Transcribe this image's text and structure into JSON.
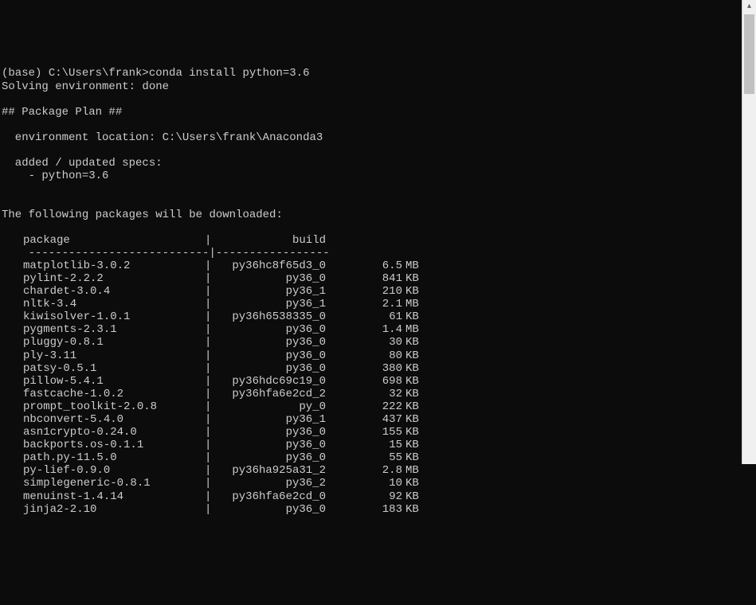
{
  "prompt": {
    "env": "(base) ",
    "path": "C:\\Users\\frank>",
    "command": "conda install python=3.6"
  },
  "solving": "Solving environment: done",
  "plan_header": "## Package Plan ##",
  "env_location_label": "  environment location: ",
  "env_location_value": "C:\\Users\\frank\\Anaconda3",
  "specs_header": "  added / updated specs:",
  "spec_item": "    - python=3.6",
  "download_header": "The following packages will be downloaded:",
  "table_header": {
    "package": "package",
    "build": "build"
  },
  "table_divider": "    ---------------------------|-----------------",
  "packages": [
    {
      "name": "matplotlib-3.0.2",
      "build": "py36hc8f65d3_0",
      "size": "6.5",
      "unit": "MB"
    },
    {
      "name": "pylint-2.2.2",
      "build": "py36_0",
      "size": "841",
      "unit": "KB"
    },
    {
      "name": "chardet-3.0.4",
      "build": "py36_1",
      "size": "210",
      "unit": "KB"
    },
    {
      "name": "nltk-3.4",
      "build": "py36_1",
      "size": "2.1",
      "unit": "MB"
    },
    {
      "name": "kiwisolver-1.0.1",
      "build": "py36h6538335_0",
      "size": "61",
      "unit": "KB"
    },
    {
      "name": "pygments-2.3.1",
      "build": "py36_0",
      "size": "1.4",
      "unit": "MB"
    },
    {
      "name": "pluggy-0.8.1",
      "build": "py36_0",
      "size": "30",
      "unit": "KB"
    },
    {
      "name": "ply-3.11",
      "build": "py36_0",
      "size": "80",
      "unit": "KB"
    },
    {
      "name": "patsy-0.5.1",
      "build": "py36_0",
      "size": "380",
      "unit": "KB"
    },
    {
      "name": "pillow-5.4.1",
      "build": "py36hdc69c19_0",
      "size": "698",
      "unit": "KB"
    },
    {
      "name": "fastcache-1.0.2",
      "build": "py36hfa6e2cd_2",
      "size": "32",
      "unit": "KB"
    },
    {
      "name": "prompt_toolkit-2.0.8",
      "build": "py_0",
      "size": "222",
      "unit": "KB"
    },
    {
      "name": "nbconvert-5.4.0",
      "build": "py36_1",
      "size": "437",
      "unit": "KB"
    },
    {
      "name": "asn1crypto-0.24.0",
      "build": "py36_0",
      "size": "155",
      "unit": "KB"
    },
    {
      "name": "backports.os-0.1.1",
      "build": "py36_0",
      "size": "15",
      "unit": "KB"
    },
    {
      "name": "path.py-11.5.0",
      "build": "py36_0",
      "size": "55",
      "unit": "KB"
    },
    {
      "name": "py-lief-0.9.0",
      "build": "py36ha925a31_2",
      "size": "2.8",
      "unit": "MB"
    },
    {
      "name": "simplegeneric-0.8.1",
      "build": "py36_2",
      "size": "10",
      "unit": "KB"
    },
    {
      "name": "menuinst-1.4.14",
      "build": "py36hfa6e2cd_0",
      "size": "92",
      "unit": "KB"
    },
    {
      "name": "jinja2-2.10",
      "build": "py36_0",
      "size": "183",
      "unit": "KB"
    }
  ]
}
